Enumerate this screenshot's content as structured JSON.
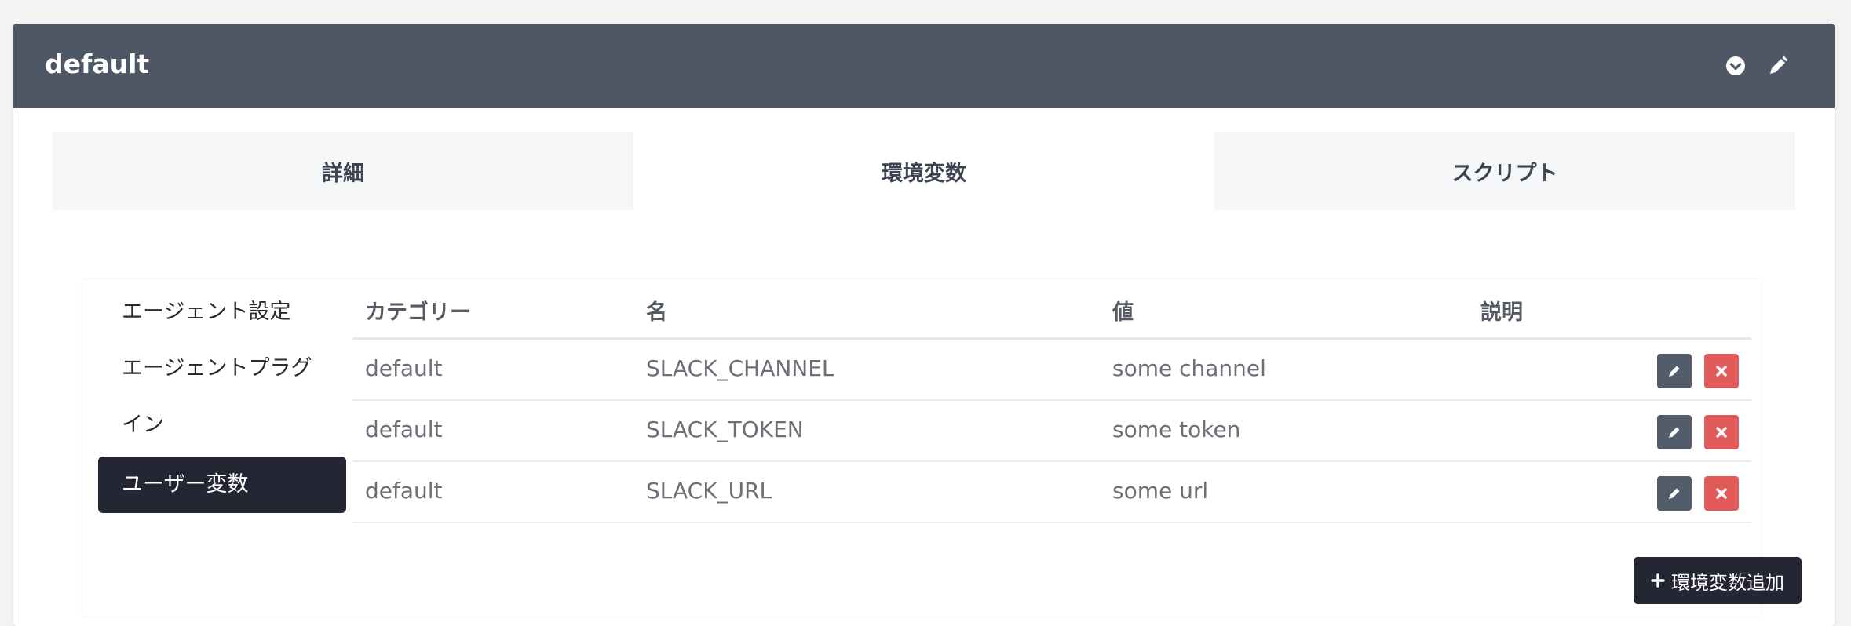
{
  "panel": {
    "title": "default"
  },
  "header_icons": [
    "chevron-down-circle-icon",
    "pencil-icon"
  ],
  "tabs": [
    {
      "label": "詳細",
      "active": false
    },
    {
      "label": "環境変数",
      "active": true
    },
    {
      "label": "スクリプト",
      "active": false
    }
  ],
  "sidebar": {
    "items": [
      {
        "label": "エージェント設定"
      },
      {
        "label_line1": "エージェントプラグ",
        "label_line2": "イン"
      },
      {
        "label": "ユーザー変数",
        "active": true
      }
    ]
  },
  "table": {
    "headers": [
      "カテゴリー",
      "名",
      "値",
      "説明"
    ],
    "rows": [
      {
        "category": "default",
        "name": "SLACK_CHANNEL",
        "value": "some channel",
        "description": ""
      },
      {
        "category": "default",
        "name": "SLACK_TOKEN",
        "value": "some token",
        "description": ""
      },
      {
        "category": "default",
        "name": "SLACK_URL",
        "value": "some url",
        "description": ""
      }
    ]
  },
  "add_button": {
    "label": "環境変数追加",
    "icon": "plus-icon"
  },
  "colors": {
    "header_bg": "#4e5766",
    "dark_accent": "#252634",
    "edit_button": "#525c6b",
    "delete_button": "#e35a5a"
  }
}
